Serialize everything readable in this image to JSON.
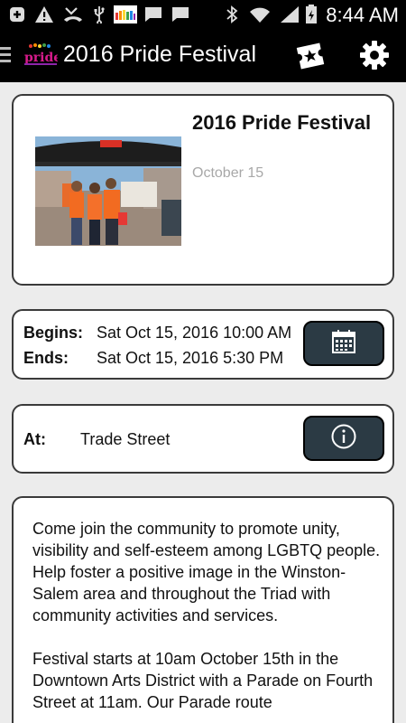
{
  "status_bar": {
    "time": "8:44 AM",
    "icons": [
      "add-notification-icon",
      "warning-icon",
      "missed-call-icon",
      "usb-icon",
      "app-thumbnail-icon",
      "message-icon",
      "message-icon",
      "bluetooth-icon",
      "wifi-icon",
      "signal-icon",
      "battery-icon"
    ]
  },
  "app_bar": {
    "title": "2016 Pride Festival",
    "logo": "pride-logo",
    "icons": [
      "menu-icon",
      "ticket-icon",
      "gear-icon"
    ]
  },
  "event": {
    "title": "2016 Pride Festival",
    "date": "October 15",
    "image": "booth-photo"
  },
  "schedule": {
    "begins_label": "Begins:",
    "begins_value": "Sat Oct 15, 2016 10:00 AM",
    "ends_label": "Ends:",
    "ends_value": "Sat Oct 15, 2016 5:30 PM",
    "button_icon": "calendar-icon"
  },
  "location": {
    "label": "At:",
    "value": "Trade Street",
    "button_icon": "info-icon"
  },
  "description": {
    "paragraph1": "Come join the community to promote unity, visibility and self-esteem among LGBTQ people. Help foster a positive image in the Winston-Salem area and throughout the Triad with community activities and services.",
    "paragraph2": "Festival starts at 10am October 15th in the Downtown Arts District with a Parade on Fourth Street at 11am. Our Parade route"
  },
  "colors": {
    "appbar": "#000000",
    "background": "#ececec",
    "button": "#2b3a44",
    "date_text": "#a8a8a8"
  }
}
